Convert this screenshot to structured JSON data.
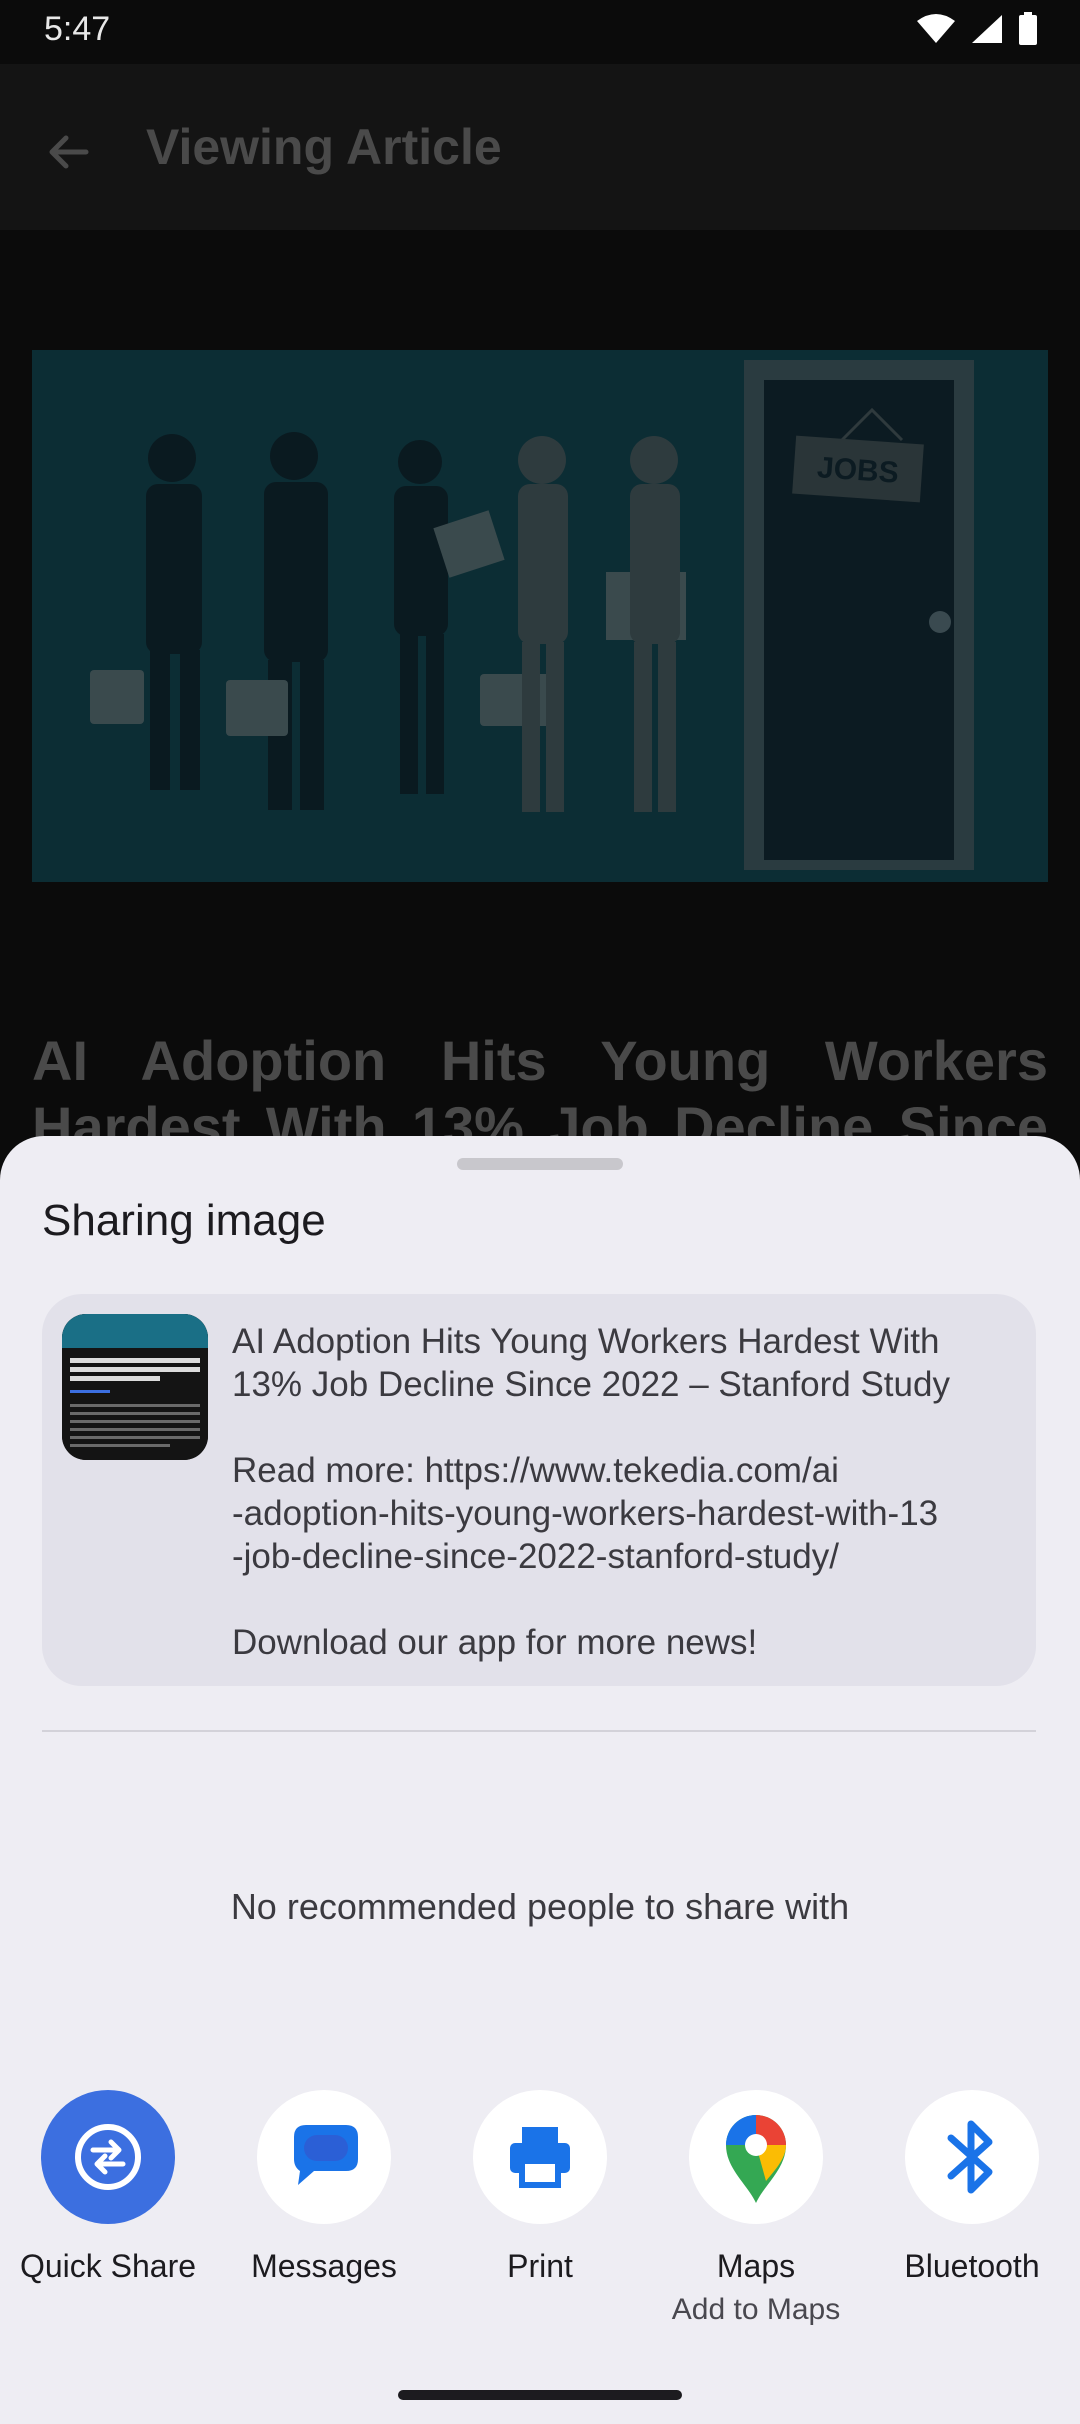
{
  "status_bar": {
    "time": "5:47",
    "icons": [
      "wifi-icon",
      "signal-icon",
      "battery-icon"
    ]
  },
  "app_bar": {
    "title": "Viewing Article",
    "back_icon": "arrow-back-icon"
  },
  "article": {
    "hero_image_text": "JOBS",
    "title": "AI Adoption Hits Young Workers Hardest With 13% Job Decline Since 2022 – Stanford Study"
  },
  "share_sheet": {
    "title": "Sharing image",
    "preview": {
      "headline_lines": [
        "AI Adoption Hits Young Workers Hardest With",
        "13% Job Decline Since 2022 – Stanford Study"
      ],
      "link_lines": [
        "Read more: https://www.tekedia.com/ai",
        "-adoption-hits-young-workers-hardest-with-13",
        "-job-decline-since-2022-stanford-study/"
      ],
      "footer_line": "Download our app for more news!"
    },
    "no_recommendations": "No recommended people to share with",
    "targets": [
      {
        "label": "Quick Share",
        "sublabel": "",
        "icon": "quick-share-icon"
      },
      {
        "label": "Messages",
        "sublabel": "",
        "icon": "messages-icon"
      },
      {
        "label": "Print",
        "sublabel": "",
        "icon": "print-icon"
      },
      {
        "label": "Maps",
        "sublabel": "Add to Maps",
        "icon": "maps-icon"
      },
      {
        "label": "Bluetooth",
        "sublabel": "",
        "icon": "bluetooth-icon"
      }
    ]
  },
  "colors": {
    "accent": "#3c6fe0",
    "sheet_background": "#eeedf3",
    "card_background": "#e2e1ea",
    "hero_teal": "#0b2c33"
  }
}
